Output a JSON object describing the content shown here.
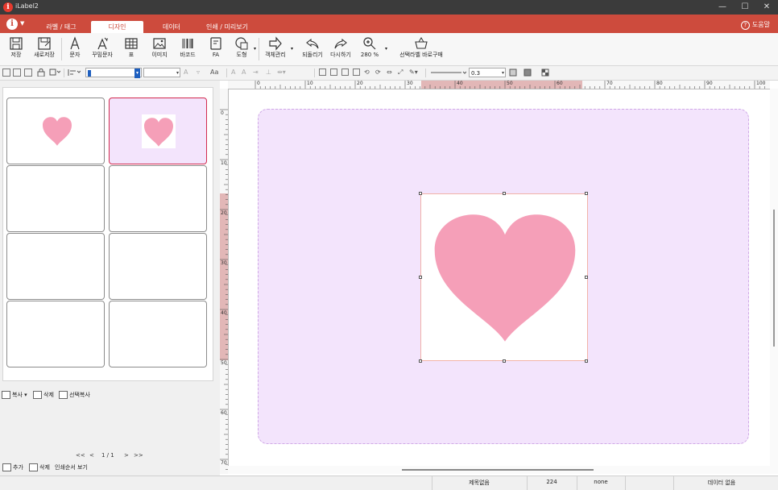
{
  "window": {
    "title": "iLabel2",
    "minimize": "—",
    "maximize": "☐",
    "close": "✕"
  },
  "tabs": [
    {
      "label": "라벨 / 태그"
    },
    {
      "label": "디자인"
    },
    {
      "label": "데이터"
    },
    {
      "label": "인쇄 / 미리보기"
    }
  ],
  "help_label": "도움말",
  "ribbon": {
    "save": "저장",
    "save_as": "새로저장",
    "text": "문자",
    "fancy_text": "꾸밈문자",
    "table": "표",
    "image": "이미지",
    "barcode": "바코드",
    "fa": "FA",
    "shape": "도형",
    "object_manage": "객체관리",
    "undo": "되돌리기",
    "redo": "다시하기",
    "zoom": "280 %",
    "buy": "선택라벨 바로구매"
  },
  "format": {
    "font_value": "",
    "size_value": "",
    "line_width": "0.3"
  },
  "left_panel": {
    "copy": "복사",
    "delete": "삭제",
    "select_copy": "선택복사",
    "pager_first": "<<",
    "pager_prev": "<",
    "pager_text": "1 / 1",
    "pager_next": ">",
    "pager_last": ">>",
    "add": "추가",
    "remove": "삭제",
    "print_order": "인쇄순서 보기"
  },
  "ruler": {
    "h_labels": [
      "0",
      "10",
      "20",
      "30",
      "40",
      "50",
      "60",
      "70",
      "80",
      "90",
      "100"
    ],
    "v_labels": [
      "0",
      "10",
      "20",
      "30",
      "40",
      "50",
      "60",
      "70"
    ]
  },
  "status": {
    "title": "제목없음",
    "value": "224",
    "none": "none",
    "data": "데이터 없음"
  },
  "colors": {
    "accent": "#cd4b3d",
    "label_bg": "#f3e4fc",
    "heart": "#f59fb8"
  }
}
